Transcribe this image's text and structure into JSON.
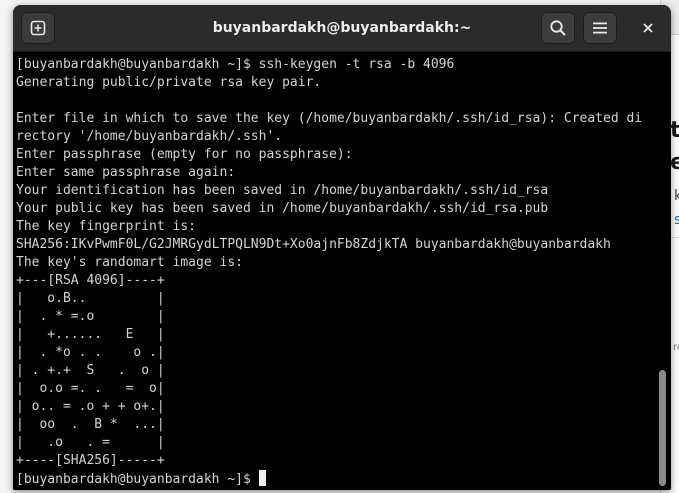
{
  "colors": {
    "terminal_bg": "#000000",
    "text": "#d3d3d3",
    "headerbar": "#2b2b2b",
    "cursor": "#f0f0f0"
  },
  "window": {
    "title": "buyanbardakh@buyanbardakh:~"
  },
  "headerbar": {
    "new_tab_icon": "new-tab-icon",
    "search_icon": "search-icon",
    "menu_icon": "hamburger-menu-icon",
    "close_icon": "close-icon"
  },
  "background_window": {
    "fragments": [
      "t",
      "e",
      "k",
      "s",
      "ro"
    ]
  },
  "terminal": {
    "lines": [
      "[buyanbardakh@buyanbardakh ~]$ ssh-keygen -t rsa -b 4096",
      "Generating public/private rsa key pair.",
      "",
      "Enter file in which to save the key (/home/buyanbardakh/.ssh/id_rsa): Created di",
      "rectory '/home/buyanbardakh/.ssh'.",
      "Enter passphrase (empty for no passphrase):",
      "Enter same passphrase again:",
      "Your identification has been saved in /home/buyanbardakh/.ssh/id_rsa",
      "Your public key has been saved in /home/buyanbardakh/.ssh/id_rsa.pub",
      "The key fingerprint is:",
      "SHA256:IKvPwmF0L/G2JMRGydLTPQLN9Dt+Xo0ajnFb8ZdjkTA buyanbardakh@buyanbardakh",
      "The key's randomart image is:",
      "+---[RSA 4096]----+",
      "|   o.B..         |",
      "|  . * =.o        |",
      "|   +......   E   |",
      "|  . *o . .    o .|",
      "| . +.+  S   .  o |",
      "|  o.o =. .   =  o|",
      "| o.. = .o + + o+.|",
      "|  oo  .  B *  ...|",
      "|   .o   . =      |",
      "+----[SHA256]-----+"
    ],
    "prompt": "[buyanbardakh@buyanbardakh ~]$ "
  }
}
